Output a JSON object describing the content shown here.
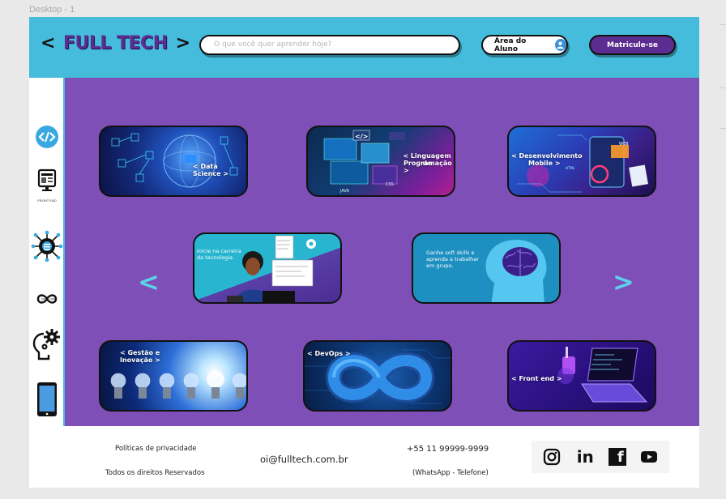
{
  "canvas": {
    "frame_label": "Desktop - 1"
  },
  "header": {
    "logo_left": "<",
    "logo_text": "FULL TECH",
    "logo_right": ">",
    "search_placeholder": "O que você quer aprender hoje?",
    "student_area_label": "Área do Aluno",
    "enroll_label": "Matricule-se"
  },
  "sidebar": {
    "items": [
      {
        "icon": "code-icon",
        "caption": ""
      },
      {
        "icon": "monitor-icon",
        "caption": "FRONT END"
      },
      {
        "icon": "circuit-icon",
        "caption": ""
      },
      {
        "icon": "infinity-icon",
        "caption": ""
      },
      {
        "icon": "gear-head-icon",
        "caption": ""
      },
      {
        "icon": "smartphone-icon",
        "caption": ""
      }
    ]
  },
  "cards": {
    "data_science": "< Data Science >",
    "linguagem_1": "< Linguagem de",
    "linguagem_2": "Programação >",
    "mobile_1": "< Desenvolvimento",
    "mobile_2": "Mobile >",
    "carreira_1": "Inicie na carreira",
    "carreira_2": "da tecnologia",
    "soft_1": "Ganhe soft skills e",
    "soft_2": "aprenda a trabalhar",
    "soft_3": "em grupo.",
    "gestao_1": "< Gestão e",
    "gestao_2": "Inovação >",
    "devops": "< DevOps >",
    "frontend": "< Front end >"
  },
  "carousel": {
    "prev": "<",
    "next": ">"
  },
  "footer": {
    "privacy": "Políticas de privacidade",
    "rights": "Todos os direitos Reservados",
    "email": "oi@fulltech.com.br",
    "phone": "+55 11 99999-9999",
    "phone_note": "(WhatsApp - Telefone)",
    "social": {
      "instagram": "instagram-icon",
      "linkedin": "in",
      "facebook": "f",
      "youtube": "youtube-icon"
    }
  },
  "colors": {
    "header": "#45bcdb",
    "brand_purple": "#5c2d91",
    "main_bg": "#7e4fb6",
    "accent_arrow": "#5fd0ea"
  }
}
